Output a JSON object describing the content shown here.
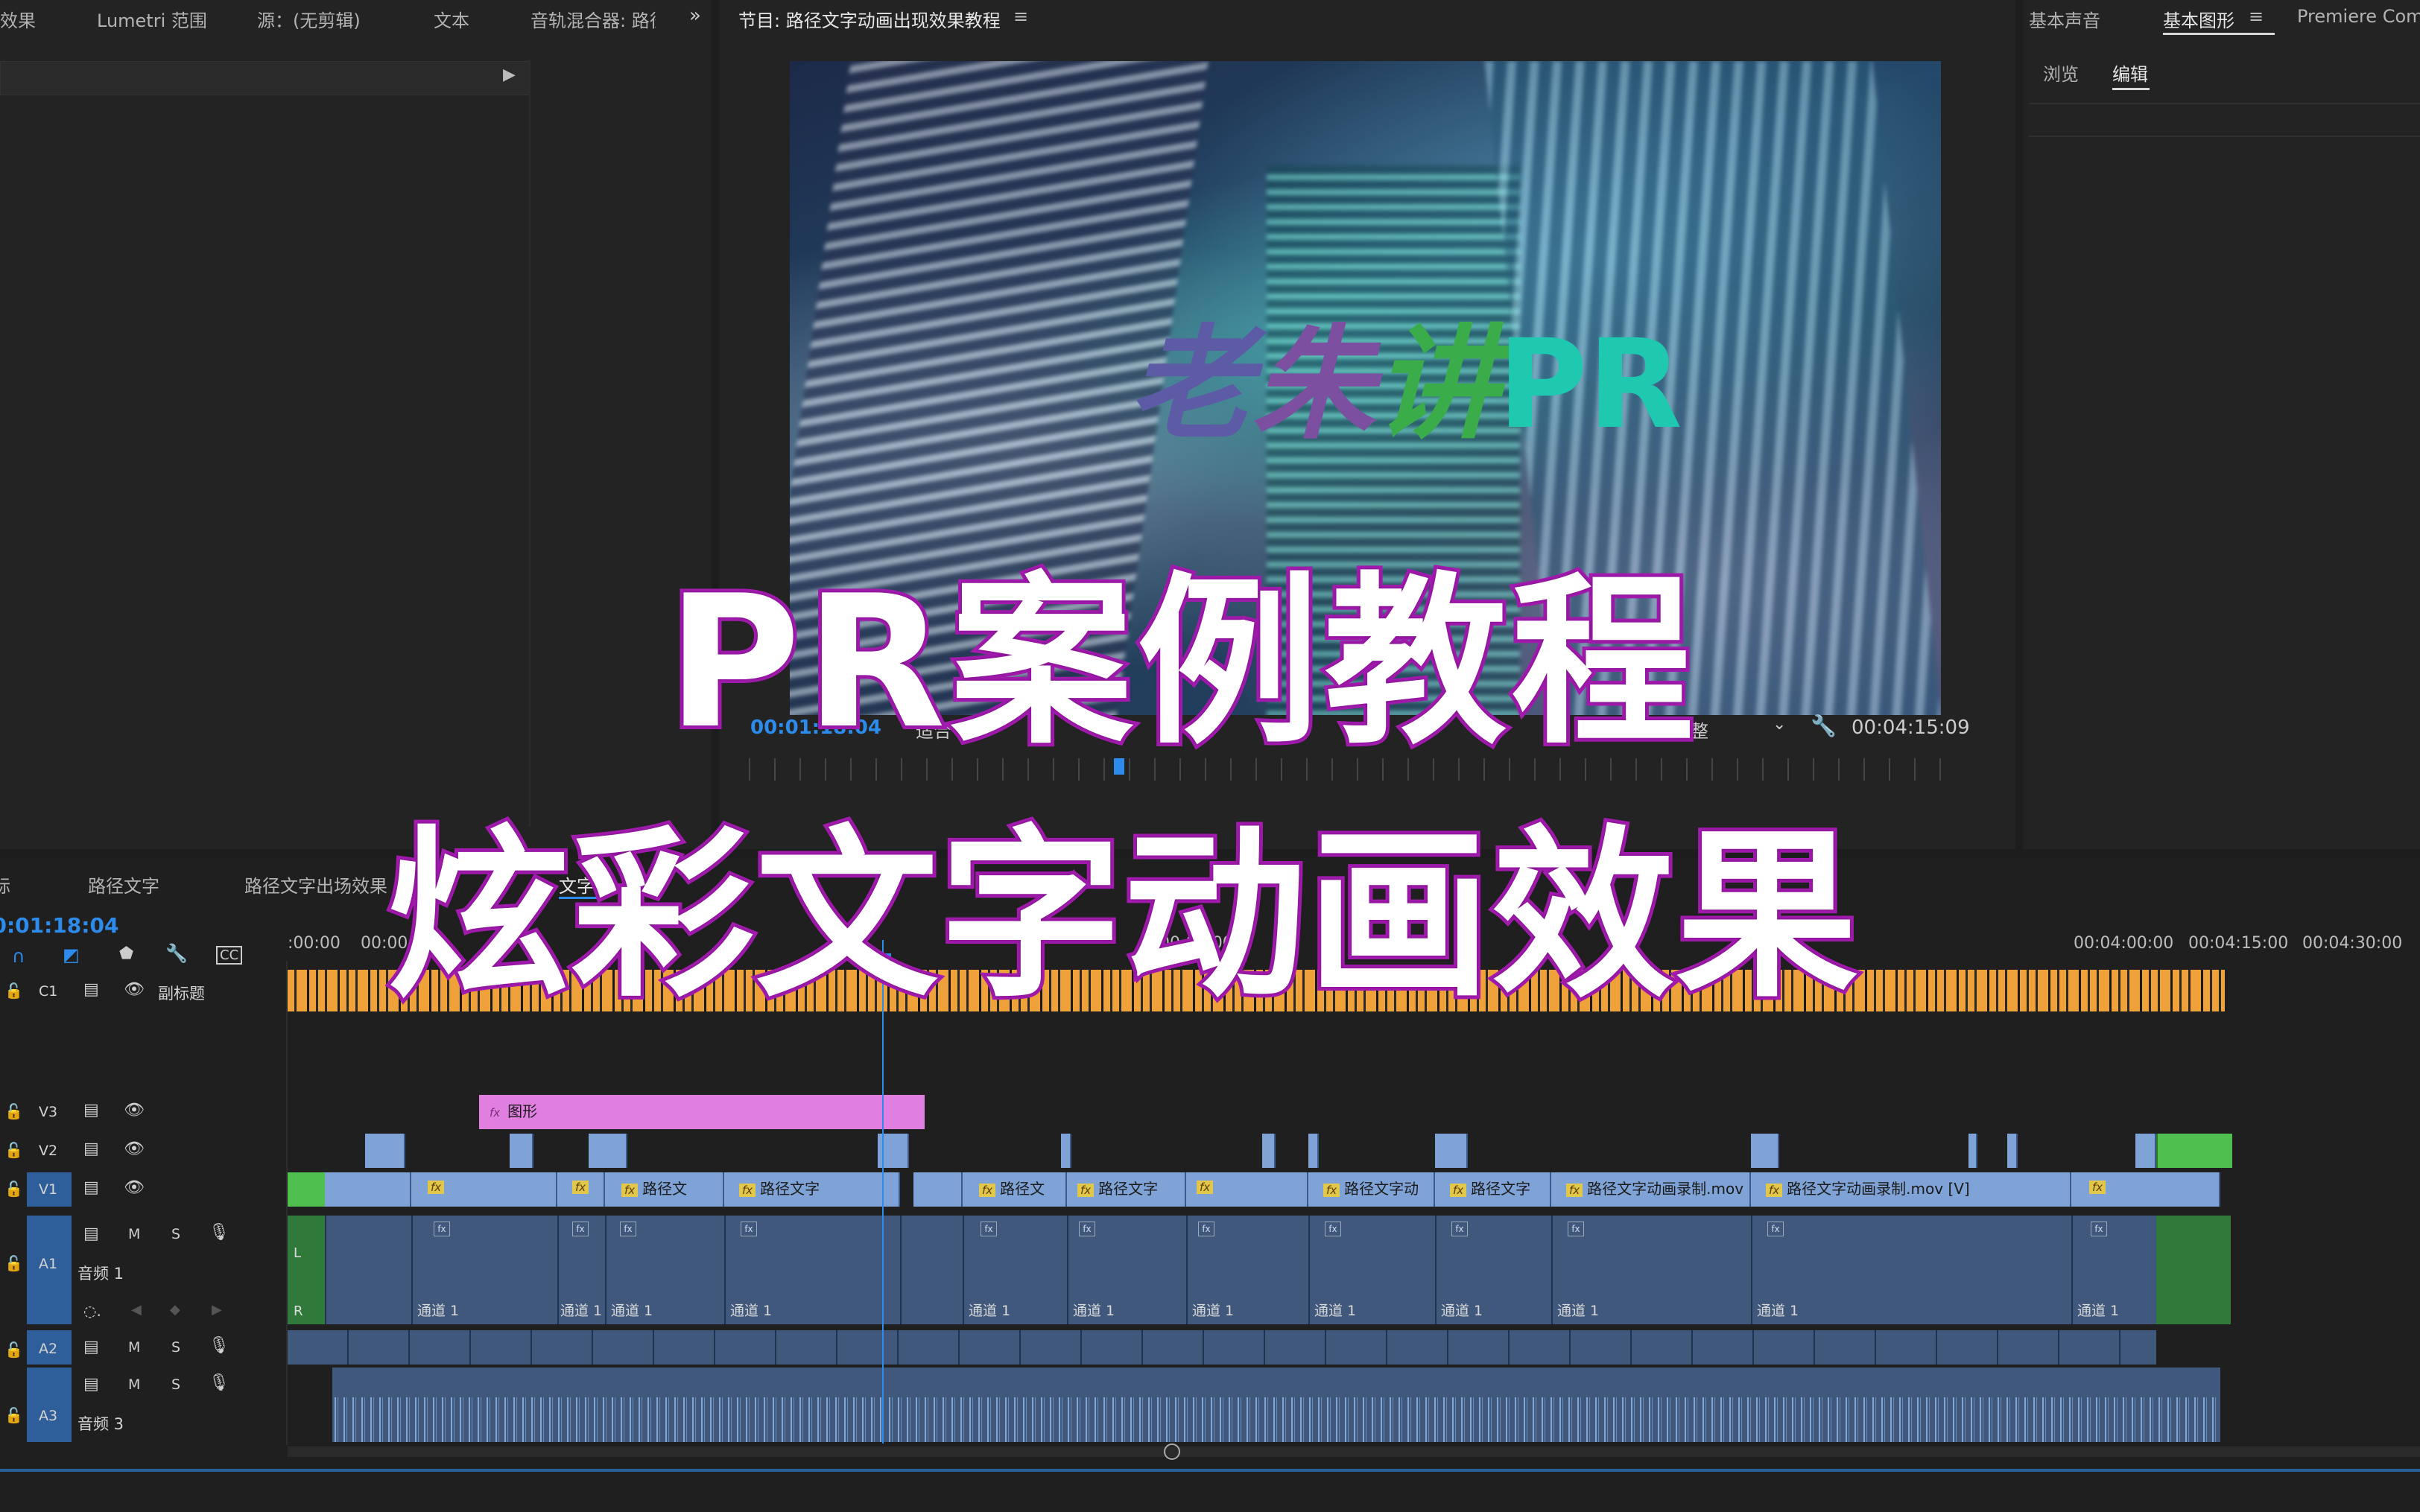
{
  "top_left_tabs": [
    "效果",
    "Lumetri 范围",
    "源：(无剪辑)",
    "文本",
    "音轨混合器: 路径"
  ],
  "program": {
    "title": "节目: 路径文字动画出现效果教程",
    "timecode_current": "00:01:18:04",
    "fit_label": "适合",
    "quality_label": "完整",
    "timecode_total": "00:04:15:09",
    "overlay_text_chars": [
      "老",
      "朱",
      "讲",
      "P",
      "R"
    ],
    "overlay_colors": [
      "#6a5aa8",
      "#7a4fa0",
      "#3aa84a",
      "#1ec9b0",
      "#1ec9b0"
    ]
  },
  "right_panel": {
    "tabs": [
      "基本声音",
      "基本图形",
      "Premiere Compo"
    ],
    "active_tab": "基本图形",
    "subtabs": [
      "浏览",
      "编辑"
    ],
    "active_subtab": "编辑"
  },
  "timeline": {
    "sequence_tabs": [
      "标",
      "路径文字",
      "路径文字出场效果",
      "文字动"
    ],
    "timecode": "00:01:18:04",
    "ruler_labels": [
      ":00:00",
      "00:00",
      "00:02:00",
      "00:04:00:00",
      "00:04:15:00",
      "00:04:30:00"
    ],
    "caption_track": {
      "id": "C1",
      "name": "副标题"
    },
    "tracks": [
      {
        "id": "V3"
      },
      {
        "id": "V2"
      },
      {
        "id": "V1"
      },
      {
        "id": "A1",
        "name": "音频 1"
      },
      {
        "id": "A2"
      },
      {
        "id": "A3",
        "name": "音频 3"
      }
    ],
    "graphic_clip_label": "图形",
    "v1_clip_labels": [
      "路径文",
      "路径文字",
      "路径文",
      "路径文字",
      "路径文字动",
      "路径文字",
      "路径文字动画录制.mov",
      "路径文字动画录制.mov [V]"
    ],
    "audio_clip_label": "通道 1",
    "mute_label": "M",
    "solo_label": "S",
    "channel_left": "L",
    "channel_right": "R"
  },
  "title_overlay": {
    "line1": "PR案例教程",
    "line2": "炫彩文字动画效果"
  },
  "colors": {
    "accent_blue": "#2d8ceb",
    "caption_orange": "#f0a23a",
    "graphic_pink": "#e07fe0",
    "clip_blue": "#7fa3d6",
    "green_clip": "#4fbf4f",
    "title_stroke": "#a41cb0"
  }
}
